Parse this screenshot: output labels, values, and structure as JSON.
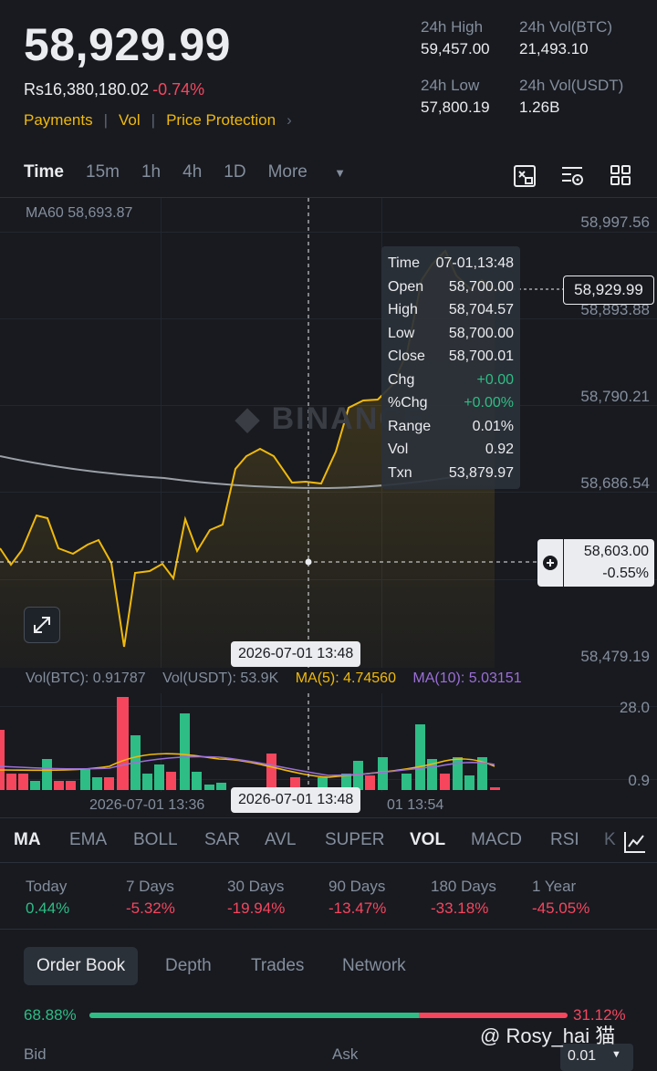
{
  "header": {
    "last_price": "58,929.99",
    "fiat_price": "Rs16,380,180.02",
    "change_pct": "-0.74%",
    "links": [
      "Payments",
      "Vol",
      "Price Protection"
    ],
    "stats": {
      "high_label": "24h High",
      "high_value": "59,457.00",
      "vol_btc_label": "24h Vol(BTC)",
      "vol_btc_value": "21,493.10",
      "low_label": "24h Low",
      "low_value": "57,800.19",
      "vol_usdt_label": "24h Vol(USDT)",
      "vol_usdt_value": "1.26B"
    }
  },
  "timeframes": {
    "items": [
      "Time",
      "15m",
      "1h",
      "4h",
      "1D",
      "More"
    ],
    "active": "Time"
  },
  "price_chart": {
    "ma_label": "MA60 58,693.87",
    "y_labels": [
      "58,997.56",
      "58,893.88",
      "58,790.21",
      "58,686.54",
      "58,479.19"
    ],
    "watermark": "BINANCE",
    "current_price_tag": "58,929.99",
    "crosshair_price": "58,603.00",
    "crosshair_pct": "-0.55%",
    "crosshair_date": "2026-07-01 13:48"
  },
  "tooltip": {
    "rows": [
      {
        "k": "Time",
        "v": "07-01,13:48"
      },
      {
        "k": "Open",
        "v": "58,700.00"
      },
      {
        "k": "High",
        "v": "58,704.57"
      },
      {
        "k": "Low",
        "v": "58,700.00"
      },
      {
        "k": "Close",
        "v": "58,700.01"
      },
      {
        "k": "Chg",
        "v": "+0.00"
      },
      {
        "k": "%Chg",
        "v": "+0.00%"
      },
      {
        "k": "Range",
        "v": "0.01%"
      },
      {
        "k": "Vol",
        "v": "0.92"
      },
      {
        "k": "Txn",
        "v": "53,879.97"
      }
    ]
  },
  "volume_chart": {
    "vol_btc": "Vol(BTC): 0.91787",
    "vol_usdt": "Vol(USDT): 53.9K",
    "ma5": "MA(5): 4.74560",
    "ma10": "MA(10): 5.03151",
    "y_top": "28.0",
    "y_bottom": "0.9",
    "x_left": "2026-07-01 13:36",
    "x_mid": "2026-07-01 13:48",
    "x_right": "01 13:54"
  },
  "indicators": {
    "items": [
      "MA",
      "EMA",
      "BOLL",
      "SAR",
      "AVL",
      "SUPER",
      "VOL",
      "MACD",
      "RSI",
      "K"
    ],
    "active": [
      "MA",
      "VOL"
    ]
  },
  "performance": [
    {
      "label": "Today",
      "value": "0.44%",
      "dir": "up"
    },
    {
      "label": "7 Days",
      "value": "-5.32%",
      "dir": "down"
    },
    {
      "label": "30 Days",
      "value": "-19.94%",
      "dir": "down"
    },
    {
      "label": "90 Days",
      "value": "-13.47%",
      "dir": "down"
    },
    {
      "label": "180 Days",
      "value": "-33.18%",
      "dir": "down"
    },
    {
      "label": "1 Year",
      "value": "-45.05%",
      "dir": "down"
    }
  ],
  "orderbook": {
    "tabs": [
      "Order Book",
      "Depth",
      "Trades",
      "Network"
    ],
    "active_tab": "Order Book",
    "bid_pct": "68.88%",
    "ask_pct": "31.12%",
    "bid_ratio": 0.6888,
    "bid_label": "Bid",
    "ask_label": "Ask",
    "precision": "0.01"
  },
  "watermark_user": "@ Rosy_hai 猫",
  "colors": {
    "up": "#2ebd85",
    "down": "#f6465d",
    "accent": "#f0b90b",
    "bg": "#181a20"
  }
}
